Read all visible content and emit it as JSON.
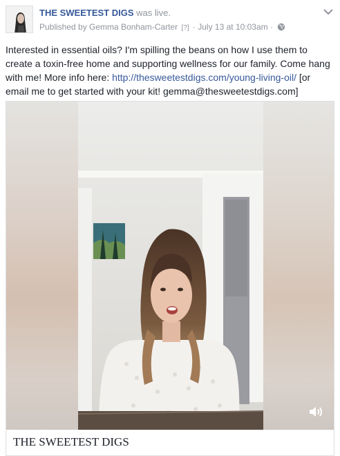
{
  "header": {
    "page_name": "THE SWEETEST DIGS",
    "action": "was live.",
    "publisher": "Published by Gemma Bonham-Carter",
    "help_marker": "[?]",
    "separator": "·",
    "timestamp": "July 13 at 10:03am",
    "privacy_icon": "globe-icon",
    "menu_icon": "chevron-down-icon"
  },
  "post": {
    "text_before_link": "Interested in essential oils? I'm spilling the beans on how I use them to create a toxin-free home and supporting wellness for our family. Come hang with me! More info here: ",
    "link": "http://thesweetestdigs.com/young-living-oil/",
    "text_after_link": " [or email me to get started with your kit! gemma@thesweetestdigs.com]"
  },
  "video": {
    "sound_icon": "speaker-icon"
  },
  "caption": {
    "title": "THE SWEETEST DIGS"
  }
}
